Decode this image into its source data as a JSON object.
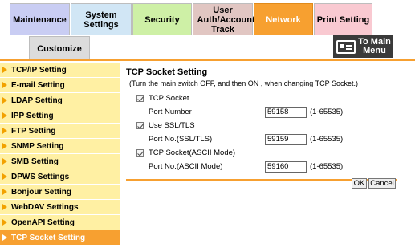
{
  "tabs": {
    "maintenance": "Maintenance",
    "system_settings": "System Settings",
    "security": "Security",
    "user_auth": "User Auth/Account Track",
    "network": "Network",
    "print_setting": "Print Setting",
    "customize": "Customize"
  },
  "main_menu": {
    "label": "To Main Menu"
  },
  "sidebar": {
    "items": [
      "TCP/IP Setting",
      "E-mail Setting",
      "LDAP Setting",
      "IPP Setting",
      "FTP Setting",
      "SNMP Setting",
      "SMB Setting",
      "DPWS Settings",
      "Bonjour Setting",
      "WebDAV Settings",
      "OpenAPI Setting",
      "TCP Socket Setting"
    ],
    "active_index": 11
  },
  "content": {
    "title": "TCP Socket Setting",
    "note": "(Turn the main switch OFF, and then ON , when changing TCP Socket.)",
    "tcp_socket": {
      "label": "TCP Socket",
      "checked": true,
      "port_label": "Port Number",
      "port_value": "59158",
      "range": "(1-65535)"
    },
    "ssl_tls": {
      "label": "Use SSL/TLS",
      "checked": true,
      "port_label": "Port No.(SSL/TLS)",
      "port_value": "59159",
      "range": "(1-65535)"
    },
    "ascii": {
      "label": "TCP Socket(ASCII Mode)",
      "checked": true,
      "port_label": "Port No.(ASCII Mode)",
      "port_value": "59160",
      "range": "(1-65535)"
    }
  },
  "buttons": {
    "ok": "OK",
    "cancel": "Cancel"
  },
  "colors": {
    "accent": "#f7a030",
    "sidebar_bg": "#fff0a3",
    "arrow": "#f2a100"
  }
}
